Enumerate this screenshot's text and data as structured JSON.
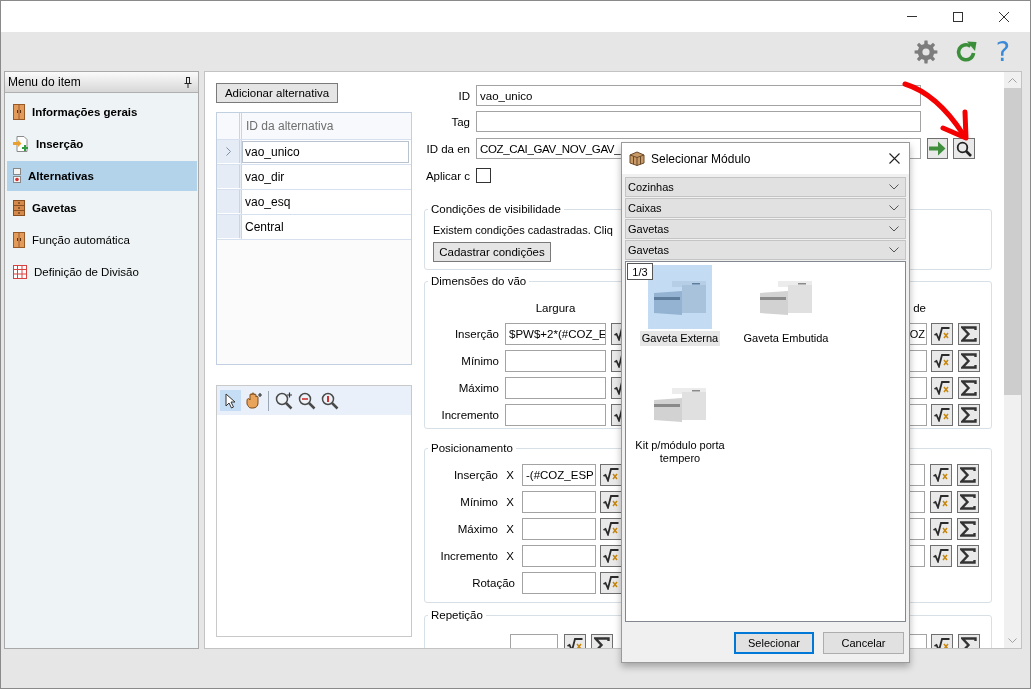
{
  "toolbar": {
    "help": "?"
  },
  "sidebar": {
    "title": "Menu do item",
    "items": [
      {
        "label": "Informações gerais",
        "bold": true,
        "selected": false
      },
      {
        "label": "Inserção",
        "bold": true,
        "selected": false
      },
      {
        "label": "Alternativas",
        "bold": true,
        "selected": true
      },
      {
        "label": "Gavetas",
        "bold": true,
        "selected": false
      },
      {
        "label": "Função automática",
        "bold": false,
        "selected": false
      },
      {
        "label": "Definição de Divisão",
        "bold": false,
        "selected": false
      }
    ]
  },
  "alternatives": {
    "add_button": "Adicionar alternativa",
    "column": "ID da alternativa",
    "rows": [
      {
        "id": "vao_unico",
        "selected": true
      },
      {
        "id": "vao_dir",
        "selected": false
      },
      {
        "id": "vao_esq",
        "selected": false
      },
      {
        "id": "Central",
        "selected": false
      }
    ]
  },
  "preview_toolbar": {
    "tools": [
      {
        "selected": true
      },
      {
        "selected": false
      },
      {
        "selected": false
      },
      {
        "selected": false
      },
      {
        "selected": false
      }
    ]
  },
  "form": {
    "fields": [
      {
        "label": "ID",
        "value": "vao_unico"
      },
      {
        "label": "Tag"
      },
      {
        "label": "ID da en",
        "value": "COZ_CAI_GAV_NOV_GAV_"
      }
    ],
    "apply": {
      "label": "Aplicar c",
      "checked": false
    }
  },
  "visibility": {
    "title": "Condições de visibilidade",
    "text": "Existem condições cadastradas. Cliq",
    "button": "Cadastrar condições"
  },
  "dimensions": {
    "title": "Dimensões do vão",
    "column_1": "Largura",
    "column_3": "de",
    "rows": [
      {
        "label": "Inserção",
        "value": "$PW$+2*(#COZ_E",
        "column_3_value": "OZ"
      },
      {
        "label": "Mínimo"
      },
      {
        "label": "Máximo"
      },
      {
        "label": "Incremento"
      }
    ]
  },
  "positioning": {
    "title": "Posicionamento",
    "rows": [
      {
        "kind": "axis",
        "label": "Inserção",
        "axis": "X",
        "value": "-(#COZ_ESP"
      },
      {
        "kind": "axis",
        "label": "Mínimo",
        "axis": "X"
      },
      {
        "kind": "axis",
        "label": "Máximo",
        "axis": "X"
      },
      {
        "kind": "axis",
        "label": "Incremento",
        "axis": "X"
      },
      {
        "kind": "rotation",
        "label": "Rotação"
      }
    ]
  },
  "repetition": {
    "title": "Repetição"
  },
  "dialog": {
    "title": "Selecionar Módulo",
    "filters": [
      "Cozinhas",
      "Caixas",
      "Gavetas",
      "Gavetas"
    ],
    "page": "1/3",
    "modules": [
      {
        "name": "Gaveta Externa",
        "selected": true
      },
      {
        "name": "Gaveta Embutida",
        "selected": false
      },
      {
        "name": "Kit p/módulo porta tempero",
        "selected": false
      }
    ],
    "buttons": [
      {
        "label": "Selecionar",
        "focused": true
      },
      {
        "label": "Cancelar",
        "focused": false
      }
    ]
  }
}
